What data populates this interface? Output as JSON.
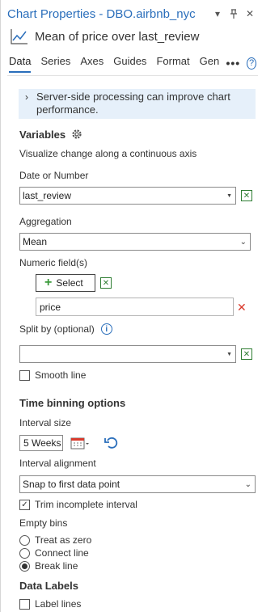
{
  "header": {
    "title": "Chart Properties - DBO.airbnb_nyc",
    "chart_title": "Mean of price over last_review"
  },
  "tabs": [
    "Data",
    "Series",
    "Axes",
    "Guides",
    "Format",
    "General"
  ],
  "banner": {
    "text": "Server-side processing can improve chart performance."
  },
  "variables": {
    "heading": "Variables",
    "description": "Visualize change along a continuous axis",
    "date_label": "Date or Number",
    "date_value": "last_review",
    "aggregation_label": "Aggregation",
    "aggregation_value": "Mean",
    "numeric_label": "Numeric field(s)",
    "select_label": "Select",
    "numeric_value": "price",
    "split_label": "Split by (optional)",
    "split_value": "",
    "smooth_label": "Smooth line",
    "smooth_checked": false
  },
  "time_binning": {
    "heading": "Time binning options",
    "interval_size_label": "Interval size",
    "interval_size_value": "5 Weeks",
    "alignment_label": "Interval alignment",
    "alignment_value": "Snap to first data point",
    "trim_label": "Trim incomplete interval",
    "trim_checked": true,
    "empty_bins_label": "Empty bins",
    "options": [
      "Treat as zero",
      "Connect line",
      "Break line"
    ],
    "selected": "Break line"
  },
  "data_labels": {
    "heading": "Data Labels",
    "label_lines": "Label lines",
    "label_lines_checked": false
  },
  "colors": {
    "accent": "#2a6ebb",
    "banner_bg": "#e6f0fa",
    "green": "#2e7d32",
    "red": "#d9392c"
  }
}
